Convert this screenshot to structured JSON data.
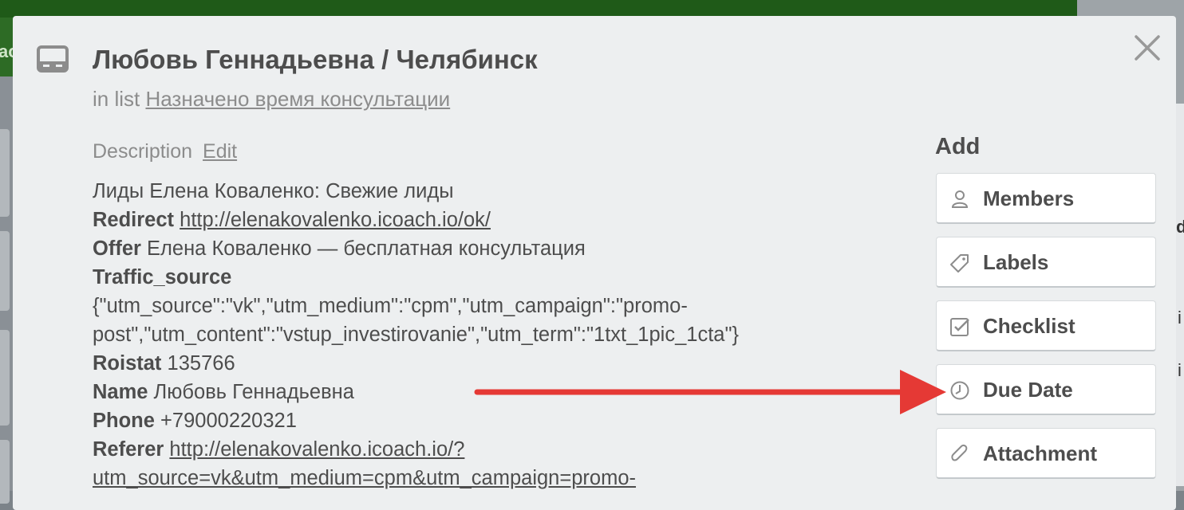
{
  "background": {
    "left_text": "ac",
    "right_letters": [
      "d",
      "i",
      "i"
    ]
  },
  "card": {
    "title": "Любовь Геннадьевна / Челябинск",
    "in_list_prefix": "in list",
    "list_name": "Назначено время консультации"
  },
  "description": {
    "label": "Description",
    "edit_label": "Edit",
    "line1": "Лиды Елена Коваленко: Свежие лиды",
    "redirect_key": "Redirect",
    "redirect_url": "http://elenakovalenko.icoach.io/ok/",
    "offer_key": "Offer",
    "offer_value": "Елена Коваленко — бесплатная консультация",
    "traffic_key": "Traffic_source",
    "traffic_line1": "{\"utm_source\":\"vk\",\"utm_medium\":\"cpm\",\"utm_campaign\":\"promo-",
    "traffic_line2": "post\",\"utm_content\":\"vstup_investirovanie\",\"utm_term\":\"1txt_1pic_1cta\"}",
    "roistat_key": "Roistat",
    "roistat_value": "135766",
    "name_key": "Name",
    "name_value": "Любовь Геннадьевна",
    "phone_key": "Phone",
    "phone_value": "+79000220321",
    "referer_key": "Referer",
    "referer_url_line1": "http://elenakovalenko.icoach.io/?",
    "referer_url_line2": "utm_source=vk&utm_medium=cpm&utm_campaign=promo-"
  },
  "sidebar": {
    "add_label": "Add",
    "buttons": [
      {
        "label": "Members",
        "icon": "person-icon"
      },
      {
        "label": "Labels",
        "icon": "tag-icon"
      },
      {
        "label": "Checklist",
        "icon": "checkbox-icon"
      },
      {
        "label": "Due Date",
        "icon": "clock-icon"
      },
      {
        "label": "Attachment",
        "icon": "paperclip-icon"
      }
    ]
  },
  "annotation": {
    "arrow_color": "#e53935",
    "points_to": "Due Date"
  }
}
